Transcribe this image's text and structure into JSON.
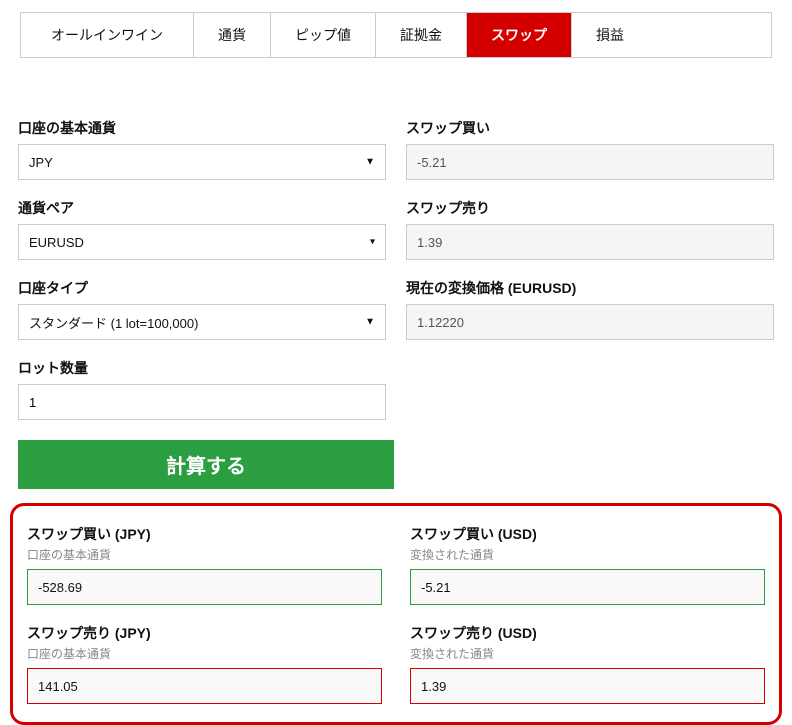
{
  "tabs": {
    "all_in_one": "オールインワイン",
    "currency": "通貨",
    "pip_value": "ピップ値",
    "margin": "証拠金",
    "swap": "スワップ",
    "profit_loss": "損益"
  },
  "left_fields": {
    "base_currency_label": "口座の基本通貨",
    "base_currency_value": "JPY",
    "pair_label": "通貨ペア",
    "pair_value": "EURUSD",
    "account_type_label": "口座タイプ",
    "account_type_value": "スタンダード (1 lot=100,000)",
    "lots_label": "ロット数量",
    "lots_value": "1"
  },
  "right_fields": {
    "swap_buy_label": "スワップ買い",
    "swap_buy_value": "-5.21",
    "swap_sell_label": "スワップ売り",
    "swap_sell_value": "1.39",
    "conv_price_label": "現在の変換価格 (EURUSD)",
    "conv_price_value": "1.12220"
  },
  "calc_button": "計算する",
  "results": {
    "buy_jpy_label": "スワップ買い (JPY)",
    "buy_jpy_sub": "口座の基本通貨",
    "buy_jpy_value": "-528.69",
    "buy_usd_label": "スワップ買い (USD)",
    "buy_usd_sub": "変換された通貨",
    "buy_usd_value": "-5.21",
    "sell_jpy_label": "スワップ売り (JPY)",
    "sell_jpy_sub": "口座の基本通貨",
    "sell_jpy_value": "141.05",
    "sell_usd_label": "スワップ売り (USD)",
    "sell_usd_sub": "変換された通貨",
    "sell_usd_value": "1.39"
  }
}
